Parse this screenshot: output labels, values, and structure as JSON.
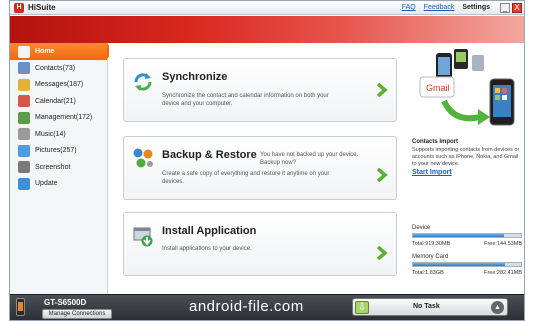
{
  "window": {
    "title": "HiSuite",
    "logo_text": "H"
  },
  "titlebar": {
    "faq": "FAQ",
    "feedback": "Feedback",
    "settings": "Settings",
    "minimize": "_",
    "close": "X"
  },
  "sidebar": {
    "items": [
      {
        "label": "Home",
        "icon": "home-icon",
        "active": true,
        "color": "#f3f3f3"
      },
      {
        "label": "Contacts(73)",
        "icon": "contacts-icon",
        "color": "#6a8fc5"
      },
      {
        "label": "Messages(187)",
        "icon": "messages-icon",
        "color": "#e2b23a"
      },
      {
        "label": "Calendar(21)",
        "icon": "calendar-icon",
        "color": "#d3584a"
      },
      {
        "label": "Management(172)",
        "icon": "management-icon",
        "color": "#5a9d46"
      },
      {
        "label": "Music(14)",
        "icon": "music-icon",
        "color": "#9b9b9b"
      },
      {
        "label": "Pictures(257)",
        "icon": "pictures-icon",
        "color": "#4f9be0"
      },
      {
        "label": "Screenshot",
        "icon": "screenshot-icon",
        "color": "#7a7a7a"
      },
      {
        "label": "Update",
        "icon": "update-icon",
        "color": "#3d8fd8"
      }
    ]
  },
  "cards": {
    "sync": {
      "title": "Synchronize",
      "desc": "Synchronize the contact and calendar information on both your device and your computer."
    },
    "backup": {
      "title": "Backup & Restore",
      "note": "You have not backed up your device. Backup now?",
      "desc": "Create a safe copy of everything and restore it anytime on your devices."
    },
    "install": {
      "title": "Install Application",
      "desc": "Install applications to your device."
    }
  },
  "promo": {
    "gmail_badge": "Gmail",
    "title": "Contacts Import",
    "desc": "Supports importing contacts from devices or accounts such as iPhone, Nokia, and Gmail to your new device.",
    "link": "Start Import"
  },
  "storage": {
    "device": {
      "label": "Device",
      "total": "Total:919.30MB",
      "free": "Free:144.53MB",
      "used_percent": 84
    },
    "memory": {
      "label": "Memory Card",
      "total": "Total:1.83GB",
      "free": "Free:282.41MB",
      "used_percent": 85
    }
  },
  "bottom": {
    "device_name": "GT-S6500D",
    "manage_button": "Manage Connections",
    "watermark": "android-file.com",
    "task_status": "No Task"
  },
  "colors": {
    "accent": "#f06a10",
    "banner": "#d9281e",
    "link": "#1f5fb8",
    "arrow": "#5bb030"
  }
}
